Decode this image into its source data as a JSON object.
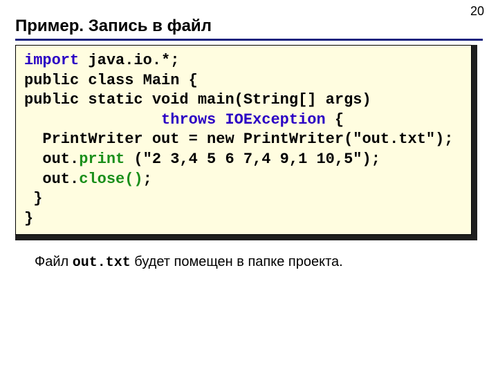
{
  "pageNumber": "20",
  "title": "Пример. Запись в файл",
  "code": {
    "l1a": "import",
    "l1b": " java.io.*;",
    "l2": "public class Main {",
    "l3": "public static void main(String[] args)",
    "l4a": "               ",
    "l4b": "throws IOException",
    "l4c": " {",
    "l5": "  PrintWriter out = new PrintWriter(\"out.txt\");",
    "l6a": "  out.",
    "l6b": "print",
    "l6c": " (\"2 3,4 5 6 7,4 9,1 10,5\");",
    "l7a": "  out.",
    "l7b": "close()",
    "l7c": ";",
    "l8": " }",
    "l9": "}"
  },
  "caption": {
    "pre": "Файл ",
    "file": "out.txt",
    "post": "  будет помещен в папке проекта."
  }
}
